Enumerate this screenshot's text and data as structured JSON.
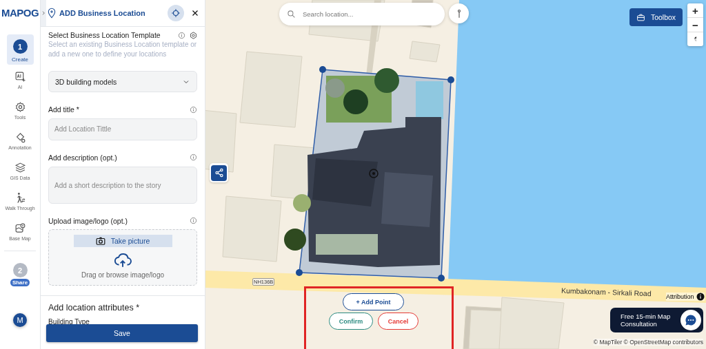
{
  "brand": {
    "logo": "MAPOG"
  },
  "rail": {
    "items": [
      {
        "kind": "step",
        "number": "1",
        "label": "Create",
        "selected": true
      },
      {
        "kind": "ai",
        "label": "AI",
        "selected": false
      },
      {
        "kind": "tools",
        "label": "Tools",
        "selected": false
      },
      {
        "kind": "annotation",
        "label": "Annotation",
        "selected": false
      },
      {
        "kind": "gis",
        "label": "GIS Data",
        "selected": false
      },
      {
        "kind": "walk",
        "label": "Walk Through",
        "selected": false
      },
      {
        "kind": "basemap",
        "label": "Base Map",
        "selected": false
      },
      {
        "kind": "step",
        "number": "2",
        "label": "Share",
        "selected": false
      }
    ],
    "user": {
      "initial": "M"
    }
  },
  "panel": {
    "title": "ADD Business Location",
    "template": {
      "heading": "Select Business Location Template",
      "hint": "Select an existing Business Location template or add a new one to define your locations",
      "value": "3D building models"
    },
    "fields": [
      {
        "kind": "input",
        "label": "Add title *",
        "placeholder": "Add Location Tittle"
      },
      {
        "kind": "textarea",
        "label": "Add description (opt.)",
        "placeholder": "Add a short description to the story"
      }
    ],
    "upload": {
      "label": "Upload image/logo (opt.)",
      "camera_button": "Take picture",
      "drop_text": "Drag or browse image/logo"
    },
    "attributes": {
      "heading": "Add location attributes *",
      "field_label": "Building Type"
    },
    "save_button": "Save"
  },
  "map": {
    "search": {
      "placeholder": "Search location..."
    },
    "toolbox_button": "Toolbox",
    "zoom_in": "+",
    "zoom_out": "−",
    "road_labels": [
      {
        "kind": "shield",
        "text": "NH136B"
      },
      {
        "kind": "name",
        "text": "Kumbakonam - Sirkali Road"
      }
    ],
    "attribution": "Attribution",
    "actions": {
      "add_point": "+ Add Point",
      "confirm": "Confirm",
      "cancel": "Cancel"
    },
    "consultation": "Free 15-min Map Consultation",
    "copyright": "© MapTiler © OpenStreetMap contributors"
  }
}
